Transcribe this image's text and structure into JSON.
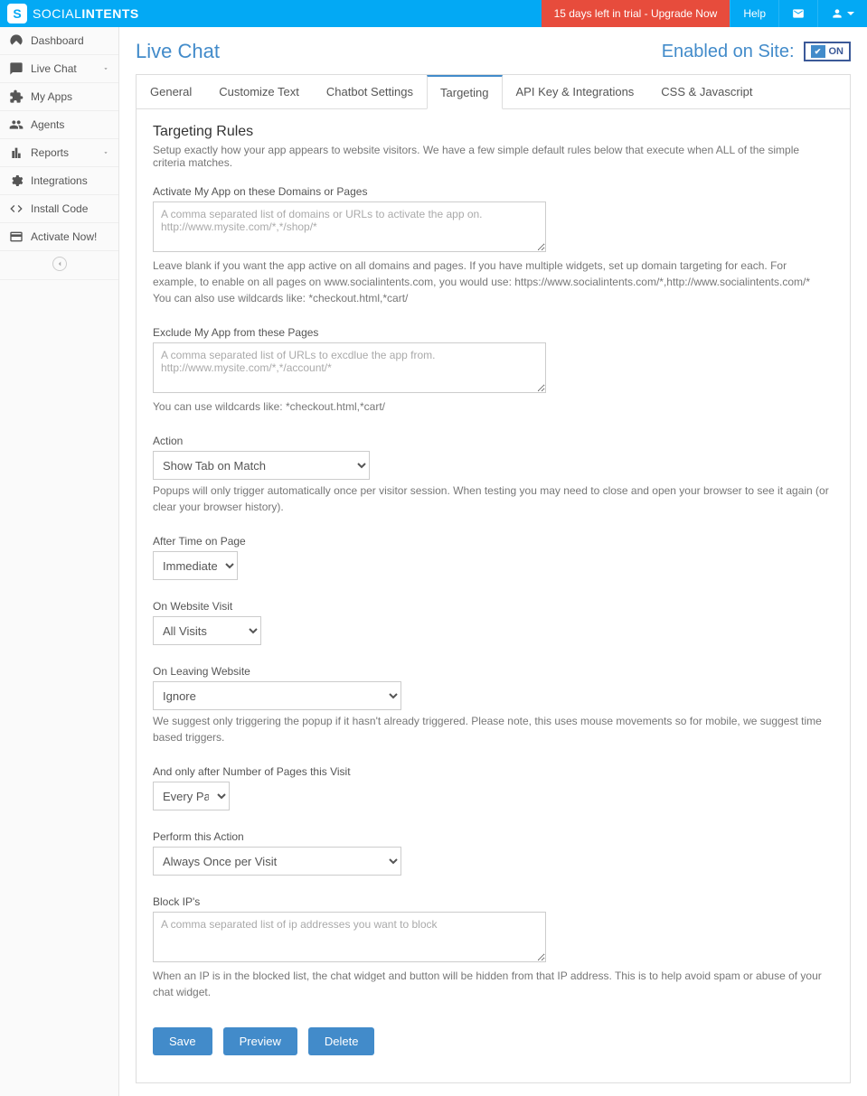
{
  "brand": {
    "s": "S",
    "thin": "SOCIAL",
    "bold": "INTENTS"
  },
  "topbar": {
    "trial": "15 days left in trial - Upgrade Now",
    "help": "Help"
  },
  "sidebar": {
    "items": [
      {
        "label": "Dashboard"
      },
      {
        "label": "Live Chat"
      },
      {
        "label": "My Apps"
      },
      {
        "label": "Agents"
      },
      {
        "label": "Reports"
      },
      {
        "label": "Integrations"
      },
      {
        "label": "Install Code"
      },
      {
        "label": "Activate Now!"
      }
    ]
  },
  "page": {
    "title": "Live Chat",
    "enabled_label": "Enabled on Site:",
    "toggle": "ON"
  },
  "tabs": [
    "General",
    "Customize Text",
    "Chatbot Settings",
    "Targeting",
    "API Key & Integrations",
    "CSS & Javascript"
  ],
  "section": {
    "title": "Targeting Rules",
    "desc": "Setup exactly how your app appears to website visitors. We have a few simple default rules below that execute when ALL of the simple criteria matches."
  },
  "fields": {
    "activate": {
      "label": "Activate My App on these Domains or Pages",
      "placeholder": "A comma separated list of domains or URLs to activate the app on.\nhttp://www.mysite.com/*,*/shop/*",
      "help": "Leave blank if you want the app active on all domains and pages. If you have multiple widgets, set up domain targeting for each. For example, to enable on all pages on www.socialintents.com, you would use: https://www.socialintents.com/*,http://www.socialintents.com/* You can also use wildcards like: *checkout.html,*cart/"
    },
    "exclude": {
      "label": "Exclude My App from these Pages",
      "placeholder": "A comma separated list of URLs to excdlue the app from.\nhttp://www.mysite.com/*,*/account/*",
      "help": "You can use wildcards like: *checkout.html,*cart/"
    },
    "action": {
      "label": "Action",
      "value": "Show Tab on Match",
      "help": "Popups will only trigger automatically once per visitor session. When testing you may need to close and open your browser to see it again (or clear your browser history)."
    },
    "after_time": {
      "label": "After Time on Page",
      "value": "Immediately"
    },
    "on_visit": {
      "label": "On Website Visit",
      "value": "All Visits"
    },
    "on_leaving": {
      "label": "On Leaving Website",
      "value": "Ignore",
      "help": "We suggest only triggering the popup if it hasn't already triggered. Please note, this uses mouse movements so for mobile, we suggest time based triggers."
    },
    "num_pages": {
      "label": "And only after Number of Pages this Visit",
      "value": "Every Page"
    },
    "perform": {
      "label": "Perform this Action",
      "value": "Always Once per Visit"
    },
    "block_ips": {
      "label": "Block IP's",
      "placeholder": "A comma separated list of ip addresses you want to block",
      "help": "When an IP is in the blocked list, the chat widget and button will be hidden from that IP address. This is to help avoid spam or abuse of your chat widget."
    }
  },
  "buttons": {
    "save": "Save",
    "preview": "Preview",
    "delete": "Delete"
  }
}
